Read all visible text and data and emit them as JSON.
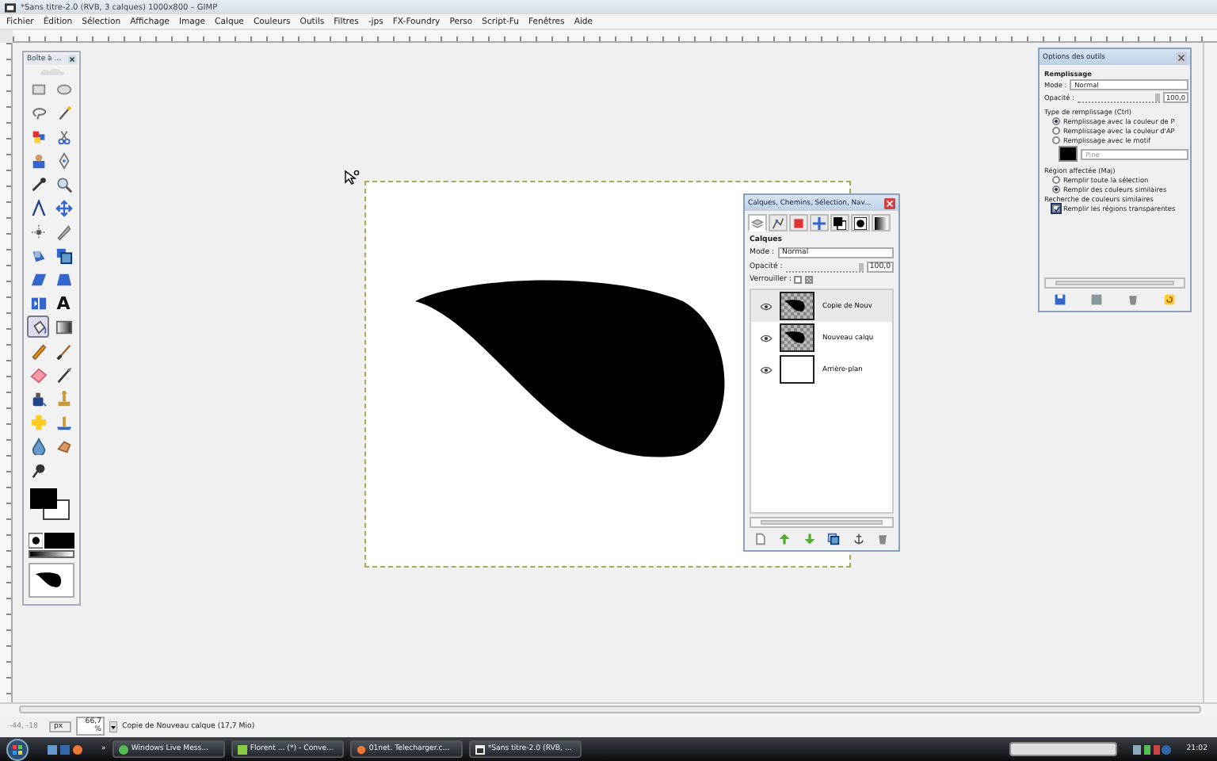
{
  "window": {
    "title": "*Sans titre-2.0 (RVB, 3 calques) 1000x800 – GIMP"
  },
  "menu": [
    "Fichier",
    "Édition",
    "Sélection",
    "Affichage",
    "Image",
    "Calque",
    "Couleurs",
    "Outils",
    "Filtres",
    "-jps",
    "FX-Foundry",
    "Perso",
    "Script-Fu",
    "Fenêtres",
    "Aide"
  ],
  "toolbox": {
    "title": "Boîte à ...",
    "tools": [
      {
        "kind": "rect",
        "selected": false
      },
      {
        "kind": "ellipse",
        "selected": false
      },
      {
        "kind": "lasso",
        "selected": false
      },
      {
        "kind": "wand",
        "selected": false
      },
      {
        "kind": "colorsel",
        "selected": false
      },
      {
        "kind": "scissors",
        "selected": false
      },
      {
        "kind": "figure",
        "selected": false
      },
      {
        "kind": "paths",
        "selected": false
      },
      {
        "kind": "picker",
        "selected": false
      },
      {
        "kind": "zoom",
        "selected": false
      },
      {
        "kind": "measure",
        "selected": false
      },
      {
        "kind": "move",
        "selected": false
      },
      {
        "kind": "align",
        "selected": false
      },
      {
        "kind": "crop",
        "selected": false
      },
      {
        "kind": "rotate",
        "selected": false
      },
      {
        "kind": "scale",
        "selected": false
      },
      {
        "kind": "shear",
        "selected": false
      },
      {
        "kind": "perspective",
        "selected": false
      },
      {
        "kind": "flip",
        "selected": false
      },
      {
        "kind": "text",
        "glyph": "A",
        "selected": false
      },
      {
        "kind": "bucket",
        "selected": true
      },
      {
        "kind": "blend",
        "selected": false
      },
      {
        "kind": "pencil",
        "selected": false
      },
      {
        "kind": "brush",
        "selected": false
      },
      {
        "kind": "eraser",
        "selected": false
      },
      {
        "kind": "airbrush",
        "selected": false
      },
      {
        "kind": "ink",
        "selected": false
      },
      {
        "kind": "clone",
        "selected": false
      },
      {
        "kind": "heal",
        "selected": false
      },
      {
        "kind": "pclone",
        "selected": false
      },
      {
        "kind": "blur",
        "selected": false
      },
      {
        "kind": "smudge",
        "selected": false
      },
      {
        "kind": "dodge",
        "selected": false
      }
    ]
  },
  "layers_dialog": {
    "title": "Calques, Chemins, Sélection, Nav...",
    "tabs": [
      {
        "kind": "layers",
        "selected": true
      },
      {
        "kind": "paths",
        "selected": false
      },
      {
        "kind": "channel",
        "selected": false
      },
      {
        "kind": "nav",
        "selected": false
      },
      {
        "kind": "colors",
        "selected": false
      },
      {
        "kind": "brush",
        "selected": false
      },
      {
        "kind": "gradient",
        "selected": false
      }
    ],
    "section": "Calques",
    "mode_label": "Mode :",
    "mode": "Normal",
    "opacity_label": "Opacité :",
    "opacity": {
      "level": 1,
      "reading": "100,0"
    },
    "lock_label": "Verrouiller :",
    "lock_pixels": false,
    "lock_alpha": false,
    "layers": [
      {
        "name": "Copie de Nouv",
        "visible": true,
        "selected": true,
        "kind": "shape"
      },
      {
        "name": "Nouveau calqu",
        "visible": true,
        "selected": false,
        "kind": "shape"
      },
      {
        "name": "Arrière-plan",
        "visible": true,
        "selected": false,
        "kind": "blank"
      }
    ]
  },
  "tool_options": {
    "title": "Options des outils",
    "tool": "Remplissage",
    "mode_label": "Mode :",
    "mode": "Normal",
    "opacity_label": "Opacité :",
    "opacity": {
      "level": 1,
      "reading": "100,0"
    },
    "fill_type_label": "Type de remplissage (Ctrl)",
    "fill_types": [
      {
        "label": "Remplissage avec la couleur de P",
        "selected": true
      },
      {
        "label": "Remplissage avec la couleur d'AP",
        "selected": false
      },
      {
        "label": "Remplissage avec le motif",
        "selected": false
      }
    ],
    "pattern": "Pine",
    "area_label": "Région affectée (Maj)",
    "areas": [
      {
        "label": "Remplir toute la sélection",
        "selected": false
      },
      {
        "label": "Remplir des couleurs similaires",
        "selected": true
      }
    ],
    "similar_label": "Recherche de couleurs similaires",
    "transparent": {
      "label": "Remplir les régions transparentes",
      "checked": true
    }
  },
  "status_bar": {
    "coords": "-44, -18",
    "unit": "px",
    "zoom": "66,7 %",
    "message": "Copie de Nouveau calque (17,7 Mio)"
  },
  "taskbar": {
    "tasks": [
      {
        "label": "Windows Live Mess...",
        "kind": "messenger"
      },
      {
        "label": "Florent ... (*) - Conve...",
        "kind": "chat"
      },
      {
        "label": "01net. Telecharger.c...",
        "kind": "browser"
      },
      {
        "label": "*Sans titre-2.0 (RVB, ...",
        "kind": "gimp"
      }
    ],
    "more": "»",
    "clock": "21:02"
  }
}
